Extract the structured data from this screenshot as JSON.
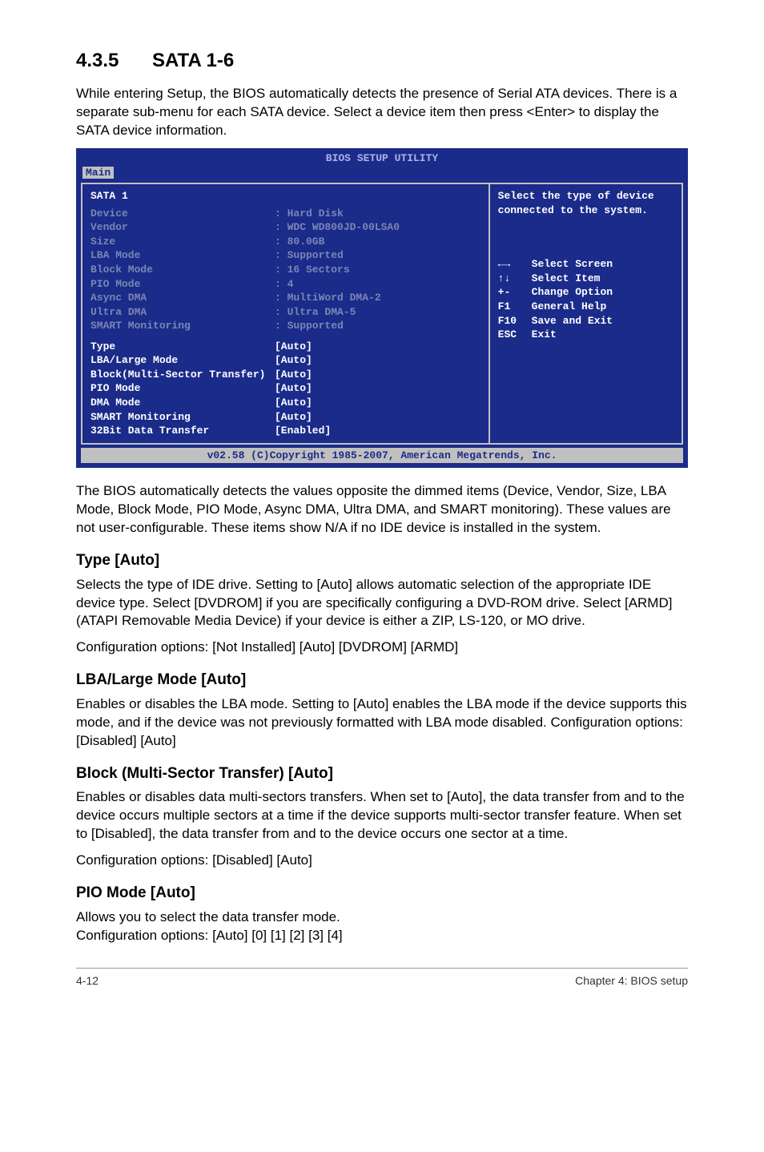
{
  "section": {
    "number": "4.3.5",
    "title": "SATA 1-6"
  },
  "intro": "While entering Setup, the BIOS automatically detects the presence of Serial ATA devices. There is a separate sub-menu for each SATA device. Select a device item then press <Enter> to display the SATA device information.",
  "bios": {
    "title": "BIOS SETUP UTILITY",
    "tab_active": "Main",
    "header": "SATA 1",
    "info_rows": [
      {
        "label": "Device",
        "value": ": Hard Disk"
      },
      {
        "label": "Vendor",
        "value": ": WDC WD800JD-00LSA0"
      },
      {
        "label": "Size",
        "value": ": 80.0GB"
      },
      {
        "label": "LBA Mode",
        "value": ": Supported"
      },
      {
        "label": "Block Mode",
        "value": ": 16 Sectors"
      },
      {
        "label": "PIO Mode",
        "value": ": 4"
      },
      {
        "label": "Async DMA",
        "value": ": MultiWord DMA-2"
      },
      {
        "label": "Ultra DMA",
        "value": ": Ultra DMA-5"
      },
      {
        "label": "SMART Monitoring",
        "value": ": Supported"
      }
    ],
    "option_rows": [
      {
        "label": "Type",
        "value": "[Auto]"
      },
      {
        "label": "LBA/Large Mode",
        "value": "[Auto]"
      },
      {
        "label": "Block(Multi-Sector Transfer)",
        "value": "[Auto]"
      },
      {
        "label": "PIO Mode",
        "value": "[Auto]"
      },
      {
        "label": "DMA Mode",
        "value": "[Auto]"
      },
      {
        "label": "SMART Monitoring",
        "value": "[Auto]"
      },
      {
        "label": "32Bit Data Transfer",
        "value": "[Enabled]"
      }
    ],
    "help_text": "Select the type of device connected to the system.",
    "keys": [
      {
        "icon": "←→",
        "text": "Select Screen"
      },
      {
        "icon": "↑↓",
        "text": "Select Item"
      },
      {
        "icon": "+-",
        "text": "Change Option"
      },
      {
        "icon": "F1",
        "text": "General Help"
      },
      {
        "icon": "F10",
        "text": "Save and Exit"
      },
      {
        "icon": "ESC",
        "text": "Exit"
      }
    ],
    "footer": "v02.58 (C)Copyright 1985-2007, American Megatrends, Inc."
  },
  "after_bios_para": "The BIOS automatically detects the values opposite the dimmed items (Device, Vendor, Size, LBA Mode, Block Mode, PIO Mode, Async DMA, Ultra DMA, and SMART monitoring). These values are not user-configurable. These items show N/A if no IDE device is installed in the system.",
  "sections": {
    "type": {
      "heading": "Type [Auto]",
      "p1": "Selects the type of IDE drive. Setting to [Auto] allows automatic selection of the appropriate IDE device type. Select [DVDROM] if you are specifically configuring a DVD-ROM drive. Select [ARMD] (ATAPI Removable Media Device) if your device is either a ZIP, LS-120, or MO drive.",
      "p2": "Configuration options: [Not Installed] [Auto] [DVDROM] [ARMD]"
    },
    "lba": {
      "heading": "LBA/Large Mode [Auto]",
      "p1": "Enables or disables the LBA mode. Setting to [Auto] enables the LBA mode if the device supports this mode, and if the device was not previously formatted with LBA mode disabled. Configuration options: [Disabled] [Auto]"
    },
    "block": {
      "heading": "Block (Multi-Sector Transfer) [Auto]",
      "p1": "Enables or disables data multi-sectors transfers. When set to [Auto], the data transfer from and to the device occurs multiple sectors at a time if the device supports multi-sector transfer feature. When set to [Disabled], the data transfer from and to the device occurs one sector at a time.",
      "p2": "Configuration options: [Disabled] [Auto]"
    },
    "pio": {
      "heading": "PIO Mode [Auto]",
      "p1": "Allows you to select the data transfer mode.",
      "p2": "Configuration options: [Auto] [0] [1] [2] [3] [4]"
    }
  },
  "footer": {
    "left": "4-12",
    "right": "Chapter 4: BIOS setup"
  }
}
